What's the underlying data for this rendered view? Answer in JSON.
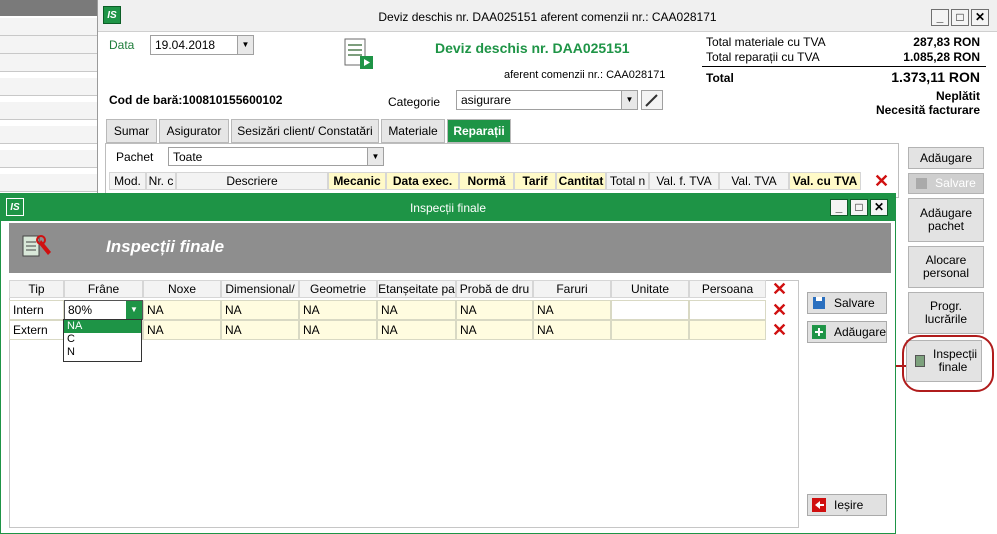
{
  "main_window": {
    "title": "Deviz deschis nr. DAA025151 aferent comenzii nr.: CAA028171",
    "logo": "IS",
    "date_label": "Data",
    "date_value": "19.04.2018",
    "heading": "Deviz deschis nr. DAA025151",
    "subheading": "aferent comenzii nr.: CAA028171",
    "barcode": "Cod de bară:100810155600102",
    "category_label": "Categorie",
    "category_value": "asigurare",
    "totals": {
      "materials_label": "Total materiale cu TVA",
      "materials_value": "287,83 RON",
      "repairs_label": "Total reparații cu TVA",
      "repairs_value": "1.085,28 RON",
      "total_label": "Total",
      "total_value": "1.373,11 RON",
      "status_paid": "Neplătit",
      "status_invoice": "Necesită facturare"
    },
    "tabs": [
      "Sumar",
      "Asigurator",
      "Sesizări client/ Constatări",
      "Materiale",
      "Reparații"
    ],
    "package_label": "Pachet",
    "package_value": "Toate",
    "repair_columns": [
      "Mod.",
      "Nr. c",
      "Descriere",
      "Mecanic",
      "Data exec.",
      "Normă",
      "Tarif",
      "Cantitat",
      "Total n",
      "Val. f. TVA",
      "Val. TVA",
      "Val. cu TVA"
    ],
    "right_buttons": [
      "Adăugare",
      "Salvare",
      "Adăugare pachet",
      "Alocare personal",
      "Progr. lucrările",
      "Inspecții finale"
    ]
  },
  "dialog": {
    "title": "Inspecții finale",
    "logo": "IS",
    "banner_title": "Inspecții finale",
    "columns": [
      "Tip",
      "Frâne",
      "Noxe",
      "Dimensional/",
      "Geometrie",
      "Etanșeitate pa",
      "Probă de dru",
      "Faruri",
      "Unitate",
      "Persoana"
    ],
    "rows": [
      {
        "tip": "Intern",
        "frane": "80%",
        "noxe": "NA",
        "dimensional": "NA",
        "geometrie": "NA",
        "etanseitate": "NA",
        "proba": "NA",
        "faruri": "NA",
        "unitate": "",
        "persoana": ""
      },
      {
        "tip": "Extern",
        "frane": "",
        "noxe": "NA",
        "dimensional": "NA",
        "geometrie": "NA",
        "etanseitate": "NA",
        "proba": "NA",
        "faruri": "NA",
        "unitate": "",
        "persoana": ""
      }
    ],
    "dropdown_options": [
      "NA",
      "C",
      "N"
    ],
    "btn_save": "Salvare",
    "btn_add": "Adăugare",
    "btn_exit": "Ieșire"
  },
  "colors": {
    "accent_green": "#1e9446",
    "delete_red": "#d01010",
    "callout_red": "#b01c1c"
  }
}
